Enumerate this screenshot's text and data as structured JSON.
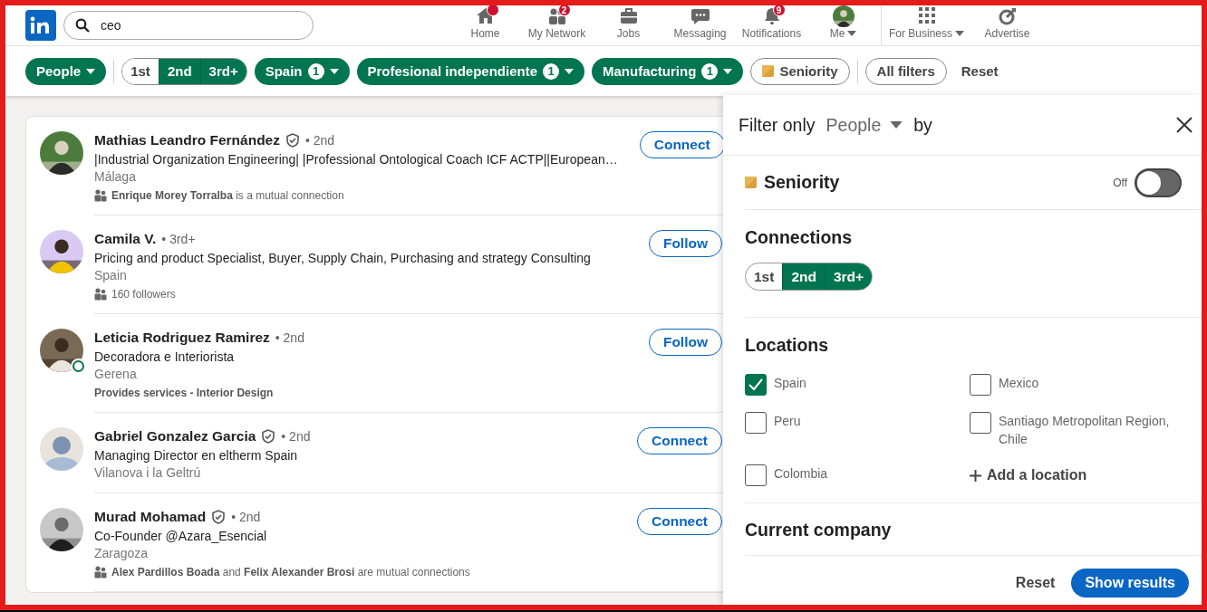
{
  "nav": {
    "search": {
      "value": "ceo"
    },
    "items": [
      {
        "kind": "home",
        "label": "Home",
        "dot_badge": true
      },
      {
        "kind": "network",
        "label": "My Network",
        "badge": "2"
      },
      {
        "kind": "jobs",
        "label": "Jobs"
      },
      {
        "kind": "messaging",
        "label": "Messaging"
      },
      {
        "kind": "notifications",
        "label": "Notifications",
        "badge": "9"
      },
      {
        "kind": "me",
        "label": "Me",
        "caret": true
      },
      {
        "kind": "business",
        "label": "For Business",
        "caret": true,
        "divider_before": true
      },
      {
        "kind": "advertise",
        "label": "Advertise"
      }
    ]
  },
  "filters": [
    {
      "kind": "dropdown",
      "label": "People",
      "selected": true
    },
    {
      "kind": "segmented",
      "divider_before": true,
      "segments": [
        {
          "label": "1st",
          "selected": false
        },
        {
          "label": "2nd",
          "selected": true
        },
        {
          "label": "3rd+",
          "selected": true
        }
      ]
    },
    {
      "kind": "dropdown",
      "label": "Spain",
      "count": "1",
      "selected": true
    },
    {
      "kind": "dropdown",
      "label": "Profesional independiente",
      "count": "1",
      "selected": true
    },
    {
      "kind": "dropdown",
      "label": "Manufacturing",
      "count": "1",
      "selected": true
    },
    {
      "kind": "premium",
      "label": "Seniority",
      "selected": false
    },
    {
      "kind": "plain",
      "label": "All filters",
      "selected": false,
      "divider_before": true
    },
    {
      "kind": "link",
      "label": "Reset"
    }
  ],
  "results": [
    {
      "name": "Mathias Leandro Fernández",
      "verified": true,
      "degree": "• 2nd",
      "headline": "|Industrial Organization Engineering| |Professional Ontological Coach ICF ACTP||European…",
      "location": "Málaga",
      "insight": {
        "kind": "people",
        "text": "**Enrique Morey Torralba** is a mutual connection"
      },
      "online": false,
      "action": "Connect"
    },
    {
      "name": "Camila V.",
      "verified": false,
      "degree": "• 3rd+",
      "headline": "Pricing and product Specialist, Buyer, Supply Chain, Purchasing and strategy Consulting",
      "location": "Spain",
      "insight": {
        "kind": "people",
        "text": "160 followers"
      },
      "online": false,
      "action": "Follow"
    },
    {
      "name": "Leticia Rodriguez Ramirez",
      "verified": false,
      "degree": "• 2nd",
      "headline": "Decoradora e Interiorista",
      "location": "Gerena",
      "insight": {
        "kind": "services",
        "text": "Provides services - Interior Design"
      },
      "online": true,
      "action": "Follow"
    },
    {
      "name": "Gabriel Gonzalez Garcia",
      "verified": true,
      "degree": "• 2nd",
      "headline": "Managing Director en eltherm Spain",
      "location": "Vilanova i la Geltrú",
      "avatar": {
        "kind": "placeholder"
      },
      "online": false,
      "action": "Connect"
    },
    {
      "name": "Murad Mohamad",
      "verified": true,
      "degree": "• 2nd",
      "headline": "Co-Founder @Azara_Esencial",
      "location": "Zaragoza",
      "insight": {
        "kind": "people",
        "text": "**Alex Pardillos Boada** and **Felix Alexander Brosi** are mutual connections"
      },
      "online": false,
      "action": "Connect"
    }
  ],
  "panel": {
    "title_start": "Filter only",
    "type_dropdown": "People",
    "title_end": "by",
    "seniority": {
      "label": "Seniority",
      "state_label": "Off",
      "on": false
    },
    "connections": {
      "title": "Connections",
      "segments": [
        {
          "label": "1st",
          "selected": false
        },
        {
          "label": "2nd",
          "selected": true
        },
        {
          "label": "3rd+",
          "selected": true
        }
      ]
    },
    "locations": {
      "title": "Locations",
      "items": [
        {
          "label": "Spain",
          "checked": true
        },
        {
          "label": "Mexico",
          "checked": false
        },
        {
          "label": "Peru",
          "checked": false
        },
        {
          "label": "Santiago Metropolitan Region, Chile",
          "checked": false
        },
        {
          "label": "Colombia",
          "checked": false
        }
      ],
      "add": "Add a location"
    },
    "current_company": {
      "title": "Current company"
    },
    "reset": "Reset",
    "show": "Show results"
  }
}
